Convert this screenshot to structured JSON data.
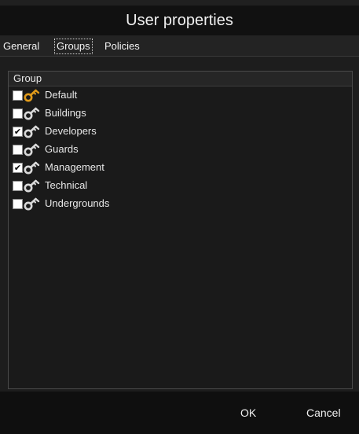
{
  "dialog": {
    "title": "User properties"
  },
  "tabs": [
    {
      "label": "General",
      "active": false
    },
    {
      "label": "Groups",
      "active": true
    },
    {
      "label": "Policies",
      "active": false
    }
  ],
  "list": {
    "column_header": "Group",
    "items": [
      {
        "label": "Default",
        "checked": false,
        "icon": "key-icon",
        "icon_color": "#e09a1a"
      },
      {
        "label": "Buildings",
        "checked": false,
        "icon": "key-icon",
        "icon_color": "#d8d8d8"
      },
      {
        "label": "Developers",
        "checked": true,
        "icon": "key-icon",
        "icon_color": "#d8d8d8"
      },
      {
        "label": "Guards",
        "checked": false,
        "icon": "key-icon",
        "icon_color": "#d8d8d8"
      },
      {
        "label": "Management",
        "checked": true,
        "icon": "key-icon",
        "icon_color": "#d8d8d8"
      },
      {
        "label": "Technical",
        "checked": false,
        "icon": "key-icon",
        "icon_color": "#d8d8d8"
      },
      {
        "label": "Undergrounds",
        "checked": false,
        "icon": "key-icon",
        "icon_color": "#d8d8d8"
      }
    ]
  },
  "buttons": {
    "ok_label": "OK",
    "cancel_label": "Cancel"
  },
  "check_glyph": "✔"
}
